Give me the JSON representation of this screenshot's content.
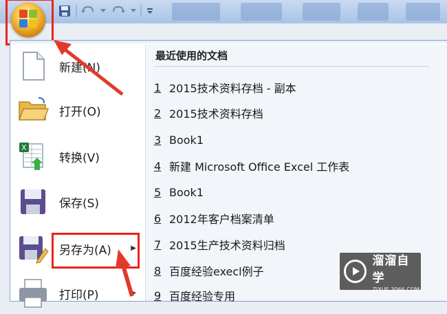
{
  "menu": {
    "items": [
      {
        "label": "新建(N)",
        "icon": "new-document-icon"
      },
      {
        "label": "打开(O)",
        "icon": "open-folder-icon"
      },
      {
        "label": "转换(V)",
        "icon": "convert-excel-icon"
      },
      {
        "label": "保存(S)",
        "icon": "save-disk-icon"
      },
      {
        "label": "另存为(A)",
        "icon": "save-as-icon"
      },
      {
        "label": "打印(P)",
        "icon": "print-icon"
      }
    ]
  },
  "recent": {
    "title": "最近使用的文档",
    "items": [
      {
        "num": "1",
        "name": "2015技术资料存档 - 副本"
      },
      {
        "num": "2",
        "name": "2015技术资料存档"
      },
      {
        "num": "3",
        "name": "Book1"
      },
      {
        "num": "4",
        "name": "新建 Microsoft Office Excel 工作表"
      },
      {
        "num": "5",
        "name": "Book1"
      },
      {
        "num": "6",
        "name": "2012年客户档案清单"
      },
      {
        "num": "7",
        "name": "2015生产技术资料归档"
      },
      {
        "num": "8",
        "name": "百度经验execl例子"
      },
      {
        "num": "9",
        "name": "百度经验专用"
      }
    ]
  },
  "watermark": {
    "cn": "溜溜自学",
    "en": "ZIXUE.3066.COM"
  },
  "colors": {
    "highlight": "#e8231c",
    "orb": "#f0a020"
  }
}
